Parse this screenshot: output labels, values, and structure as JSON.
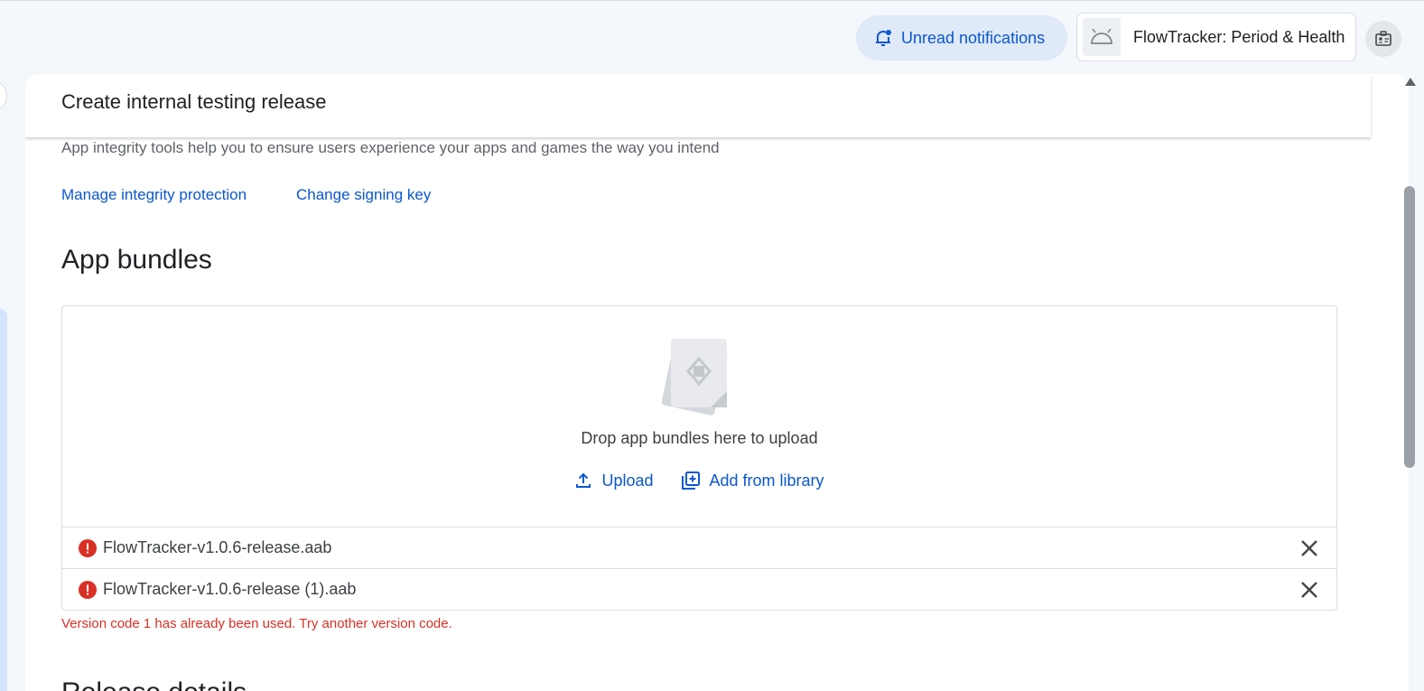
{
  "topbar": {
    "notifications_label": "Unread notifications",
    "app_name": "FlowTracker: Period & Health"
  },
  "panel": {
    "title": "Create internal testing release",
    "integrity_text": "App integrity tools help you to ensure users experience your apps and games the way you intend",
    "links": {
      "manage": "Manage integrity protection",
      "signing": "Change signing key"
    },
    "section_heading": "App bundles",
    "dropzone": {
      "text": "Drop app bundles here to upload",
      "upload_label": "Upload",
      "library_label": "Add from library"
    },
    "files": [
      {
        "name": "FlowTracker-v1.0.6-release.aab"
      },
      {
        "name": "FlowTracker-v1.0.6-release (1).aab"
      }
    ],
    "error_text": "Version code 1 has already been used. Try another version code.",
    "next_heading": "Release details"
  },
  "colors": {
    "accent": "#0b57d0",
    "error": "#d93025",
    "notif_bg": "#dfe9f8"
  },
  "icons": {
    "notification": "notification-bell-icon",
    "app": "android-icon",
    "account": "account-badge-icon",
    "upload": "upload-icon",
    "library": "add-to-library-icon",
    "error": "error-icon",
    "close": "close-icon"
  }
}
